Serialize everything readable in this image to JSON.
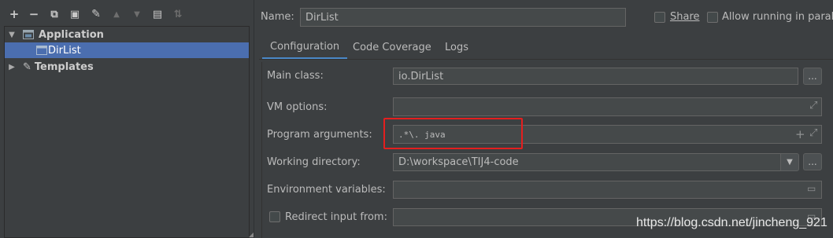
{
  "toolbar": {
    "add": "+",
    "remove": "−",
    "copy": "⧉",
    "save": "▣",
    "edit": "✎",
    "up": "▲",
    "down": "▼",
    "folder": "▤",
    "sort": "⇅"
  },
  "tree": {
    "application": "Application",
    "dirlist": "DirList",
    "templates": "Templates"
  },
  "header": {
    "name_label": "Name:",
    "name_value": "DirList",
    "share": "Share",
    "allow_parallel": "Allow running in parallel"
  },
  "tabs": [
    "Configuration",
    "Code Coverage",
    "Logs"
  ],
  "form": {
    "main_class_label": "Main class:",
    "main_class_value": "io.DirList",
    "vm_options_label": "VM options:",
    "vm_options_value": "",
    "program_args_label": "Program arguments:",
    "program_args_value": ".*\\. java",
    "working_dir_label": "Working directory:",
    "working_dir_value": "D:\\workspace\\TIJ4-code",
    "env_vars_label": "Environment variables:",
    "env_vars_value": "",
    "redirect_label": "Redirect input from:",
    "redirect_value": "",
    "browse": "...",
    "expand": "⤢",
    "plus": "+",
    "dropdown": "▼",
    "folder_icon": "▭"
  },
  "watermark": "https://blog.csdn.net/jincheng_921",
  "colors": {
    "highlight": "#e41f1f",
    "selection": "#4b6eaf",
    "tab_underline": "#4a88c7"
  }
}
